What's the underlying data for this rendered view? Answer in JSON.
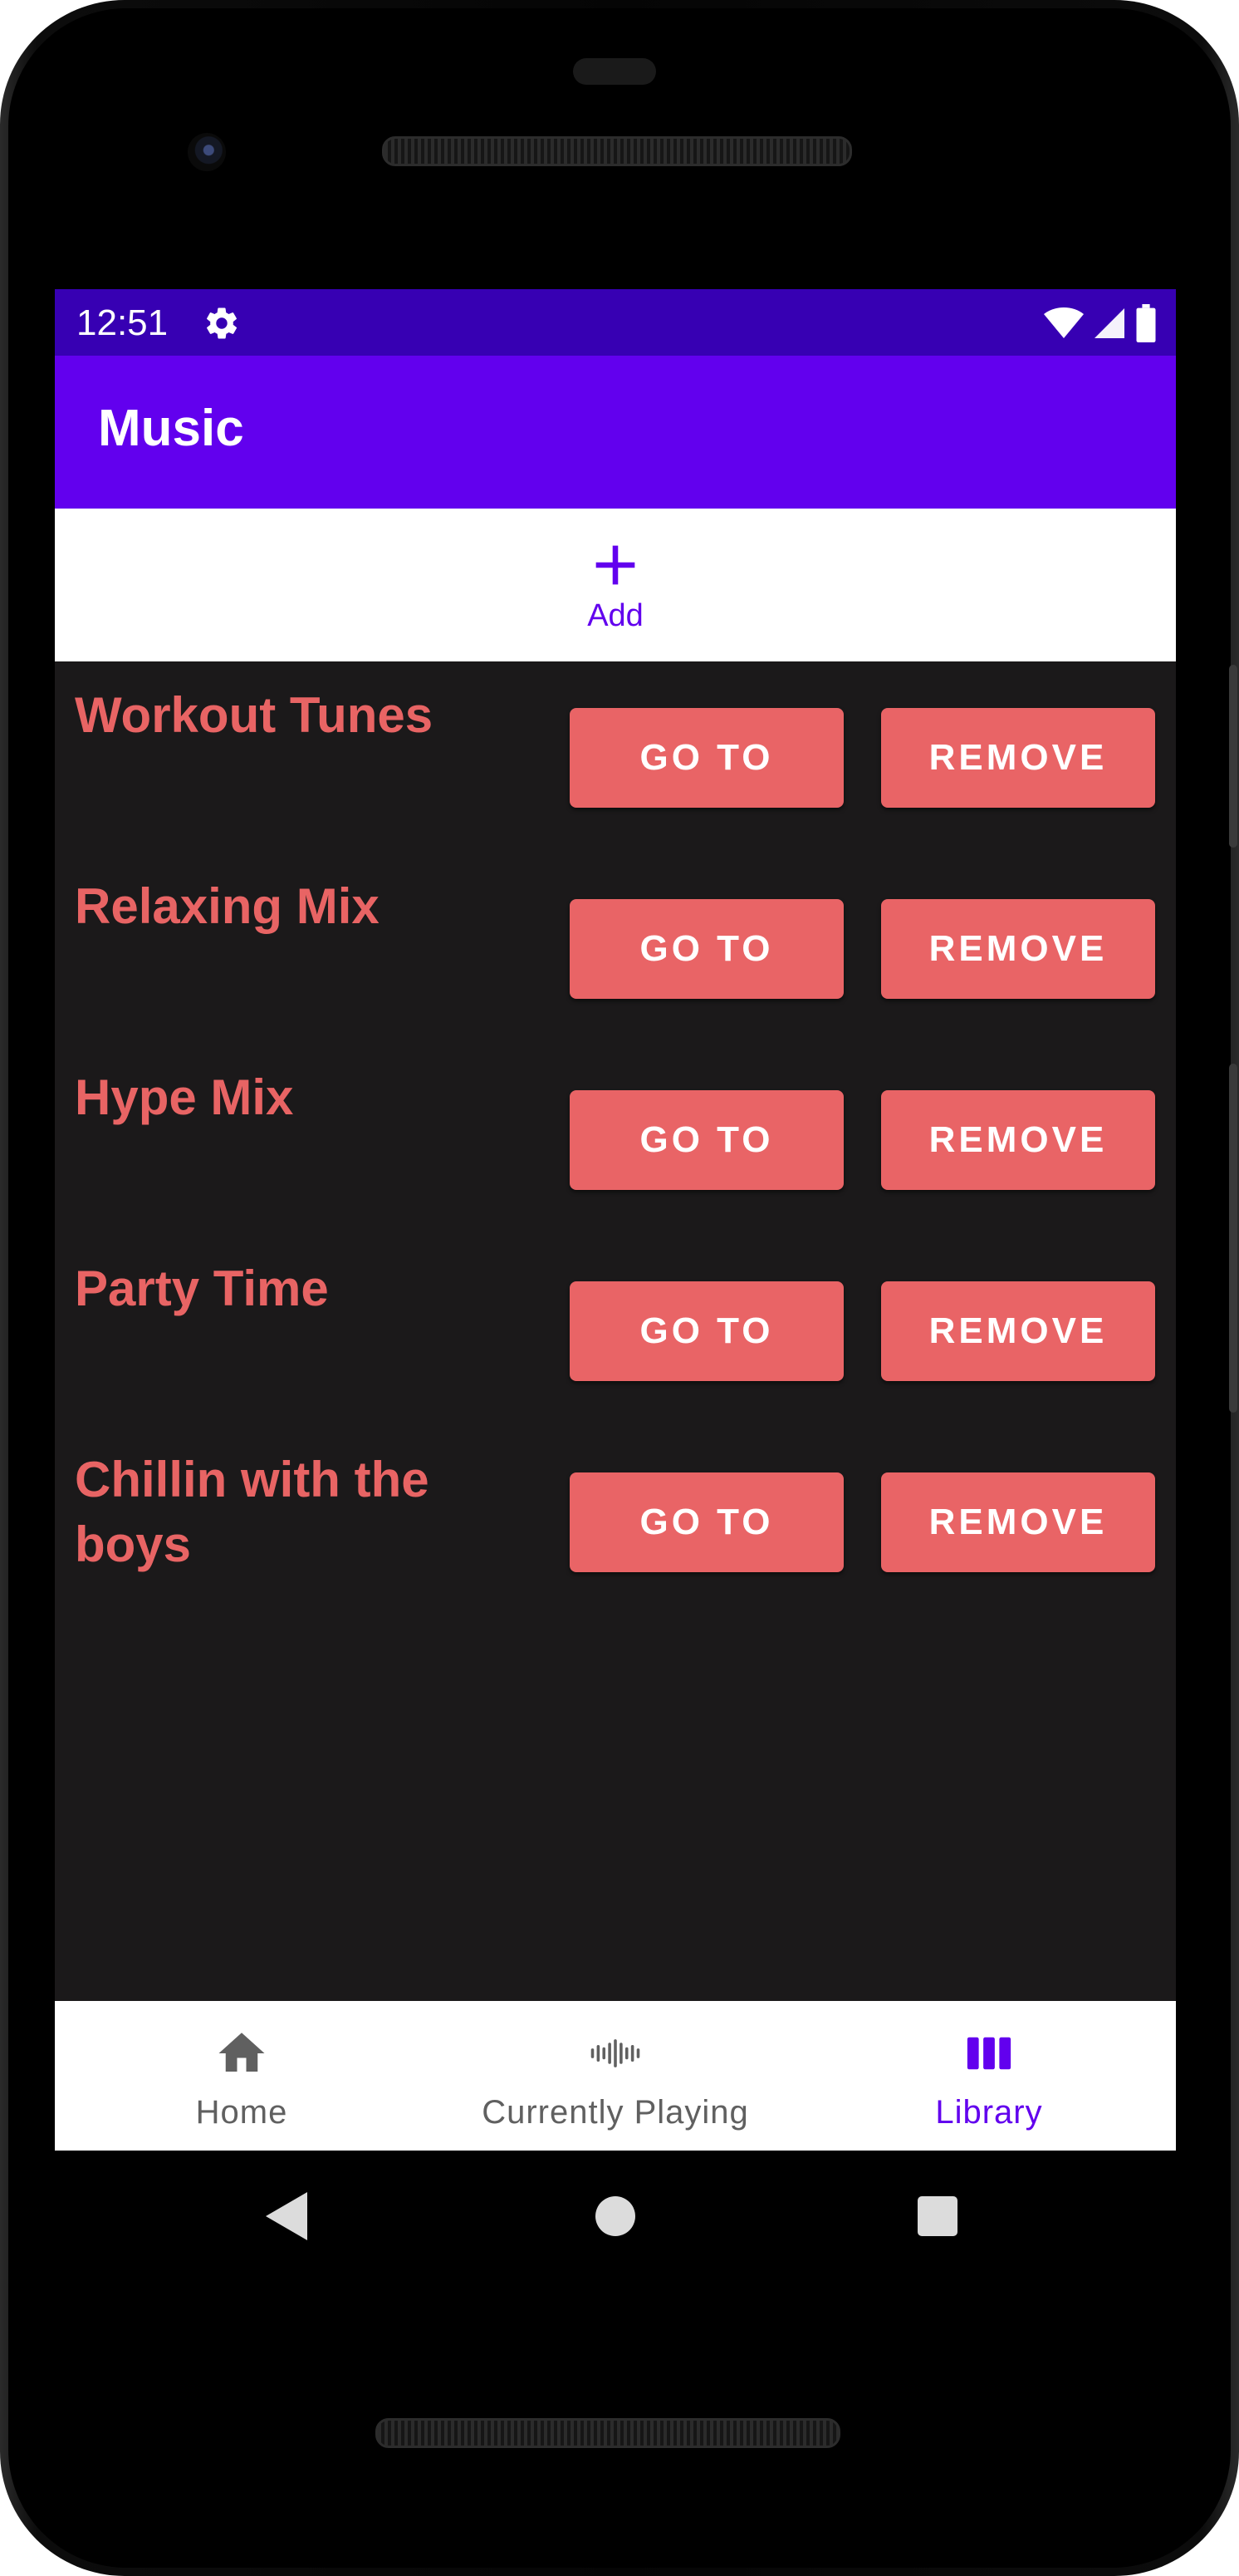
{
  "status_bar": {
    "time": "12:51",
    "icons": [
      "settings-icon",
      "wifi-icon",
      "signal-icon",
      "battery-icon"
    ]
  },
  "app_bar": {
    "title": "Music"
  },
  "add_action": {
    "label": "Add",
    "icon": "plus-icon"
  },
  "playlists": [
    {
      "name": "Workout Tunes",
      "goto_label": "GO TO",
      "remove_label": "REMOVE"
    },
    {
      "name": "Relaxing Mix",
      "goto_label": "GO TO",
      "remove_label": "REMOVE"
    },
    {
      "name": "Hype Mix",
      "goto_label": "GO TO",
      "remove_label": "REMOVE"
    },
    {
      "name": "Party Time",
      "goto_label": "GO TO",
      "remove_label": "REMOVE"
    },
    {
      "name": "Chillin with the boys",
      "goto_label": "GO TO",
      "remove_label": "REMOVE"
    }
  ],
  "bottom_nav": {
    "items": [
      {
        "label": "Home",
        "icon": "home-icon",
        "active": false
      },
      {
        "label": "Currently Playing",
        "icon": "audio-wave-icon",
        "active": false
      },
      {
        "label": "Library",
        "icon": "library-icon",
        "active": true
      }
    ]
  },
  "system_nav": {
    "buttons": [
      "back-icon",
      "home-circle-icon",
      "recents-icon"
    ]
  },
  "colors": {
    "primary": "#6200ee",
    "primary_dark": "#3700b3",
    "accent_button": "#e96466",
    "title_text": "#e86464",
    "background": "#1b191a"
  }
}
